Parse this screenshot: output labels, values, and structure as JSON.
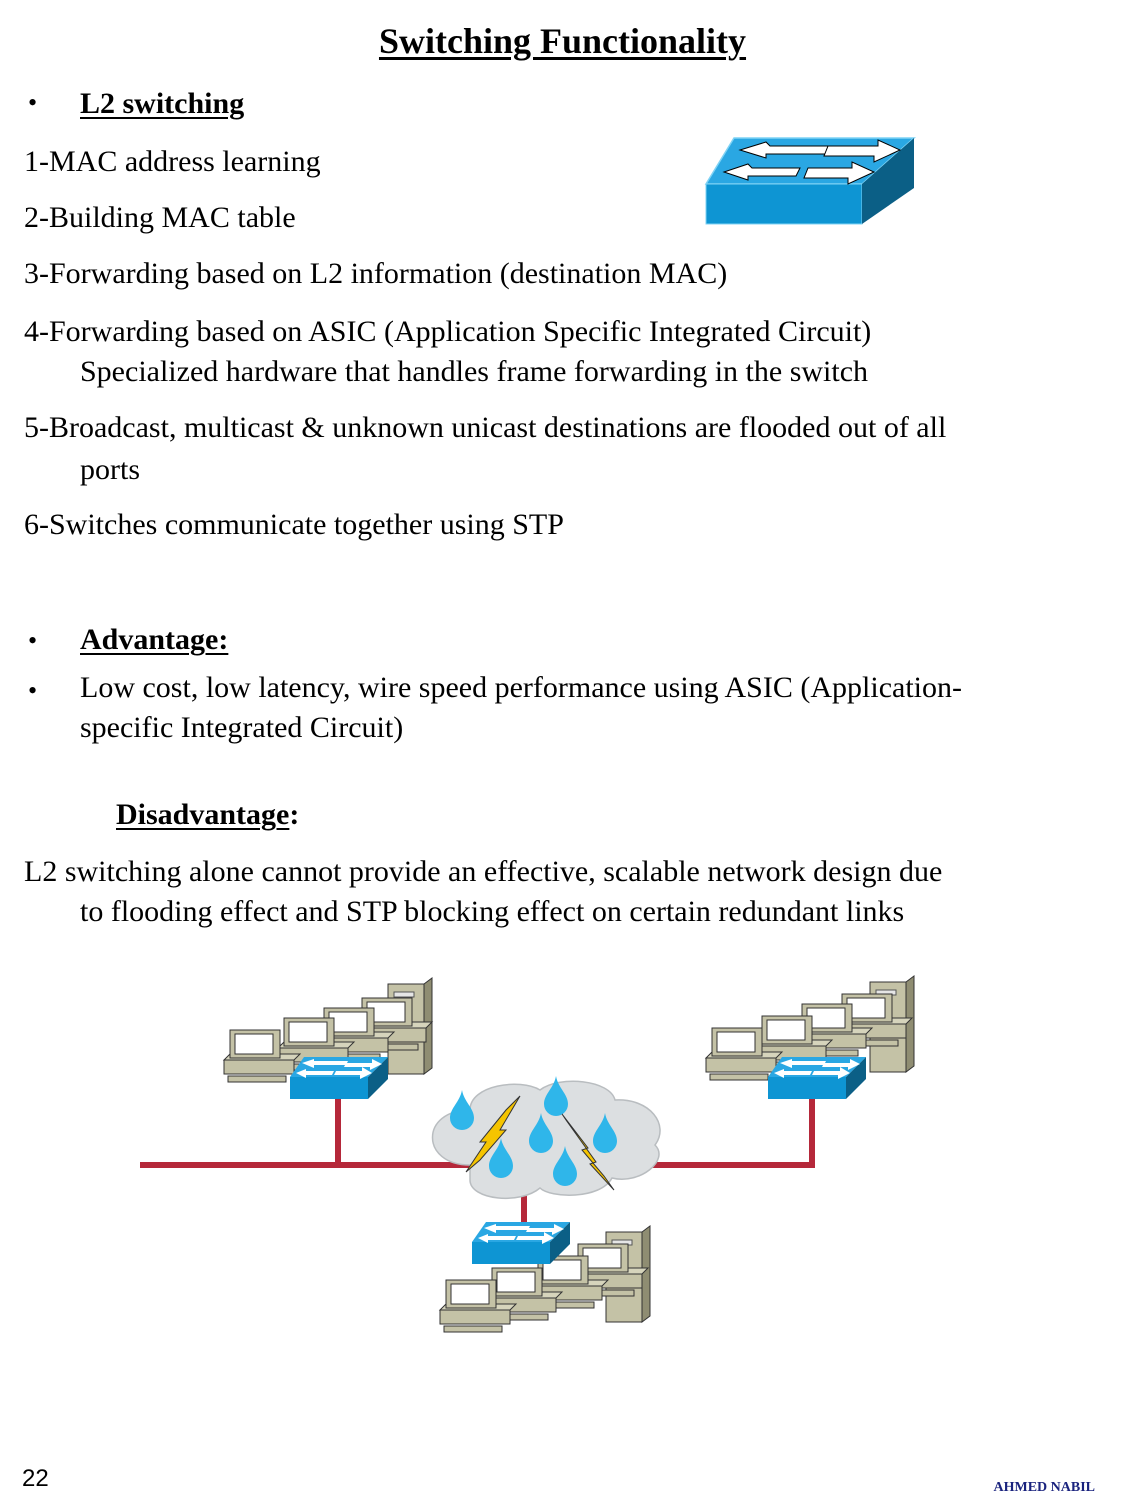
{
  "title": "Switching Functionality",
  "l2_section": {
    "bullet": "•",
    "heading": "L2 switching",
    "items": [
      "1-MAC address learning",
      "2-Building MAC table",
      "3-Forwarding based on L2 information (destination MAC)",
      "4-Forwarding based on ASIC (Application Specific Integrated Circuit)",
      "Specialized hardware that handles frame forwarding in the switch",
      "5-Broadcast, multicast & unknown unicast destinations are flooded out of all",
      "ports",
      "6-Switches communicate together using STP"
    ]
  },
  "advantage": {
    "bullet": "•",
    "heading": "Advantage:",
    "text_line1": "Low cost, low latency, wire speed performance using ASIC (Application-",
    "text_line2": "specific Integrated Circuit)"
  },
  "disadvantage": {
    "heading": "Disadvantage",
    "colon": ":",
    "text_line1": "L2 switching alone cannot provide an effective, scalable network design due",
    "text_line2": "to flooding effect and STP blocking effect on certain redundant links"
  },
  "diagram": {
    "icons": [
      "switch-icon",
      "workstation-icon",
      "server-icon",
      "cloud-icon",
      "lightning-icon",
      "raindrop-icon"
    ],
    "colors": {
      "switch": "#1a9ad6",
      "link": "#b5283a",
      "cloud": "#dcdfe1",
      "drop": "#2fb6ea",
      "bolt": "#f5c400",
      "pc": "#c4c2a6"
    }
  },
  "footer": {
    "page_number": "22",
    "author": "AHMED NABIL"
  }
}
